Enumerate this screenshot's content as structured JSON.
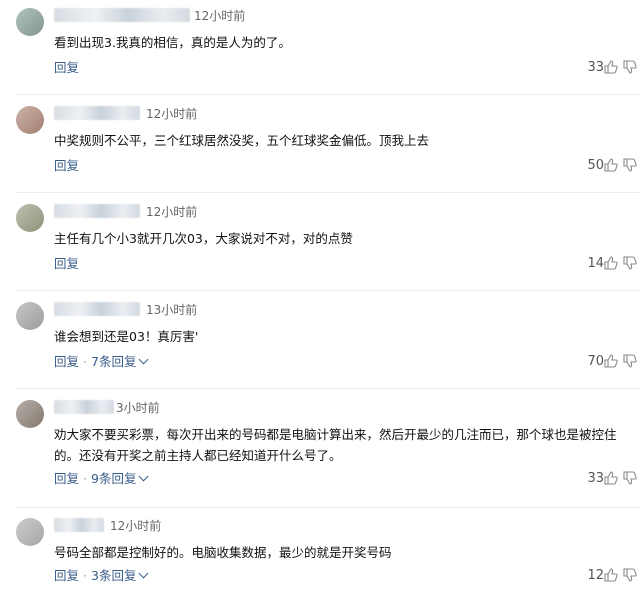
{
  "comments": [
    {
      "time": "12小时前",
      "text": "看到出现3.我真的相信，真的是人为的了。",
      "reply_label": "回复",
      "replies_label": "",
      "likes": "33",
      "avatar_color": "#8aa39a"
    },
    {
      "time": "12小时前",
      "text": "中奖规则不公平，三个红球居然没奖，五个红球奖金偏低。顶我上去",
      "reply_label": "回复",
      "replies_label": "",
      "likes": "50",
      "avatar_color": "#b08a7a"
    },
    {
      "time": "12小时前",
      "text": "主任有几个小3就开几次03，大家说对不对，对的点赞",
      "reply_label": "回复",
      "replies_label": "",
      "likes": "14",
      "avatar_color": "#9a9f84"
    },
    {
      "time": "13小时前",
      "text": "谁会想到还是03！真厉害'",
      "reply_label": "回复",
      "replies_label": "7条回复",
      "likes": "70",
      "avatar_color": "#a9a9a9"
    },
    {
      "time": "3小时前",
      "text": "劝大家不要买彩票，每次开出来的号码都是电脑计算出来，然后开最少的几注而已，那个球也是被控住的。还没有开奖之前主持人都已经知道开什么号了。",
      "reply_label": "回复",
      "replies_label": "9条回复",
      "likes": "33",
      "avatar_color": "#8f8379"
    },
    {
      "time": "12小时前",
      "text": "号码全部都是控制好的。电脑收集数据，最少的就是开奖号码",
      "reply_label": "回复",
      "replies_label": "3条回复",
      "likes": "12",
      "avatar_color": "#b3b3b3"
    }
  ]
}
